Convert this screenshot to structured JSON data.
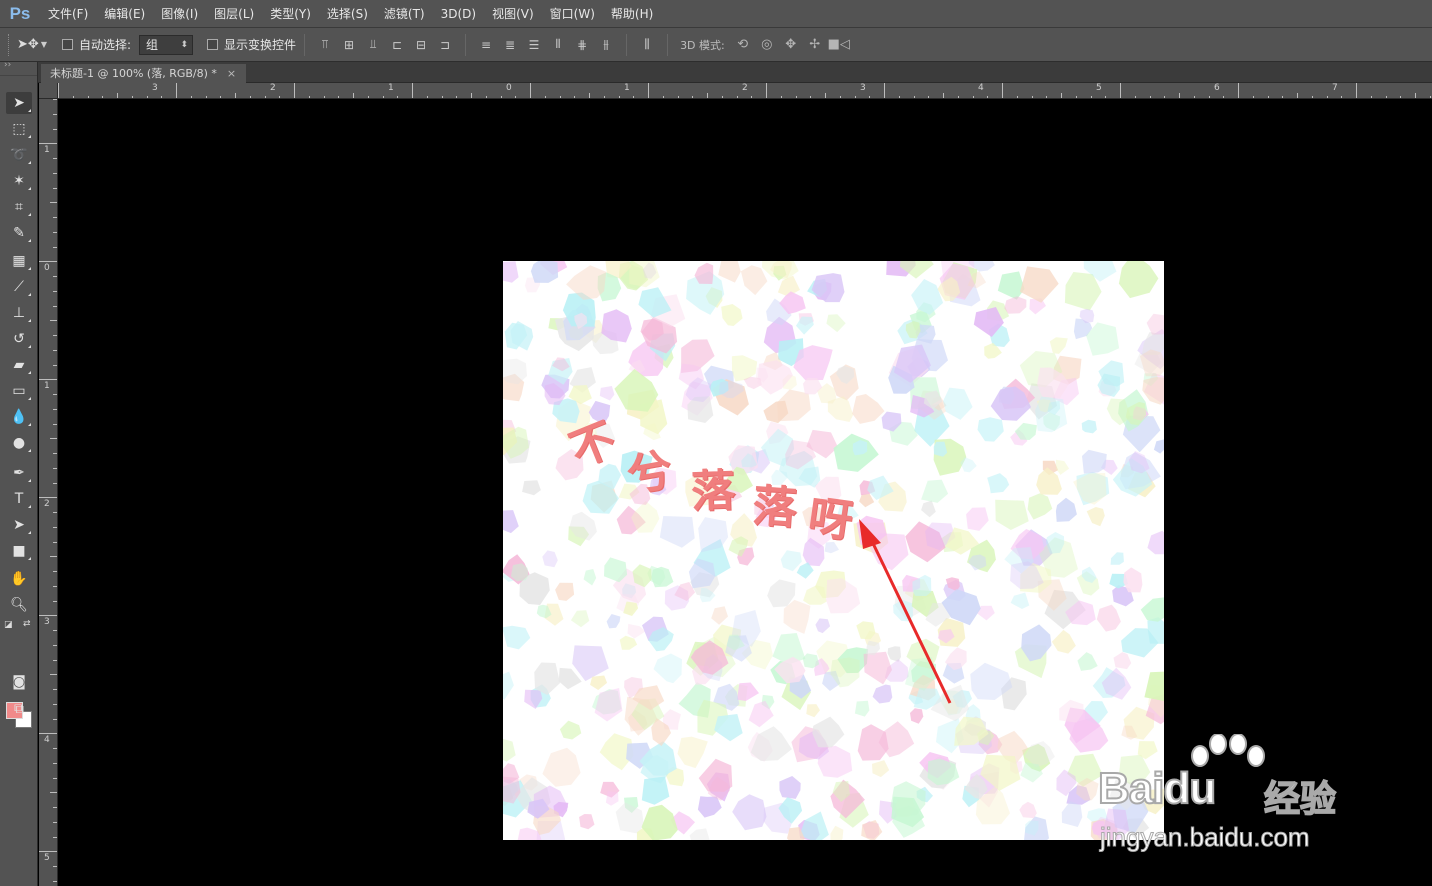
{
  "app": {
    "logo": "Ps"
  },
  "menu": [
    "文件(F)",
    "编辑(E)",
    "图像(I)",
    "图层(L)",
    "类型(Y)",
    "选择(S)",
    "滤镜(T)",
    "3D(D)",
    "视图(V)",
    "窗口(W)",
    "帮助(H)"
  ],
  "options": {
    "auto_select_label": "自动选择:",
    "auto_select_value": "组",
    "show_transform_label": "显示变换控件",
    "mode_3d_label": "3D 模式:"
  },
  "document": {
    "tab_title": "未标题-1 @ 100% (落, RGB/8) *",
    "close_glyph": "×"
  },
  "rulers": {
    "horizontal_labels": [
      "3",
      "2",
      "1",
      "0",
      "1",
      "2",
      "3",
      "4",
      "5",
      "6",
      "7"
    ],
    "vertical_labels": [
      "1",
      "0",
      "1",
      "2",
      "3",
      "4",
      "5"
    ]
  },
  "artwork": {
    "text_chars": [
      "不",
      "兮",
      "落",
      "落",
      "呀"
    ],
    "text_color": "#f07e7e",
    "arrow_color": "#e82a2a"
  },
  "colors": {
    "foreground": "#f08a8a",
    "background": "#ffffff"
  },
  "watermark": {
    "brand": "Bai",
    "brand_tail": "du",
    "cn": "经验",
    "url": "jingyan.baidu.com"
  },
  "icons": {
    "move": "move-tool-icon",
    "marquee": "rect-marquee-icon",
    "lasso": "lasso-icon",
    "wand": "magic-wand-icon",
    "crop": "crop-icon",
    "eyedropper": "eyedropper-icon",
    "healing": "healing-brush-icon",
    "brush": "brush-icon",
    "stamp": "clone-stamp-icon",
    "history": "history-brush-icon",
    "eraser": "eraser-icon",
    "gradient": "gradient-icon",
    "blur": "blur-icon",
    "dodge": "dodge-icon",
    "pen": "pen-icon",
    "type": "type-icon",
    "path": "path-select-icon",
    "shape": "rectangle-shape-icon",
    "hand": "hand-icon",
    "zoom": "zoom-icon",
    "quickmask": "quick-mask-icon",
    "screen": "screen-mode-icon"
  }
}
